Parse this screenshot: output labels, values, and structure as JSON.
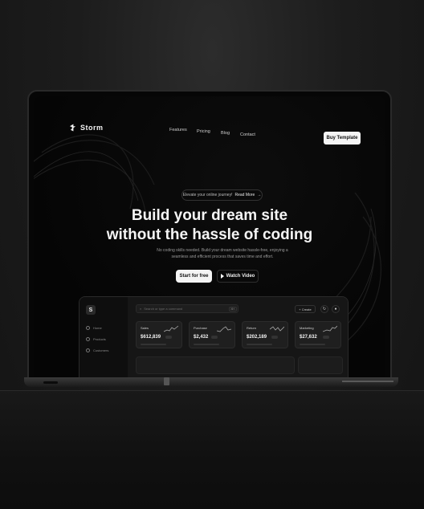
{
  "brand": {
    "name": "Storm"
  },
  "nav": {
    "items": [
      "Features",
      "Pricing",
      "Blog",
      "Contact"
    ],
    "cta": "Buy Template"
  },
  "hero": {
    "pill_text": "Elevate your online journey!",
    "pill_link": "Read More",
    "title_line1": "Build your dream site",
    "title_line2": "without the hassle of coding",
    "subtitle_line1": "No coding skills needed. Build your dream website hassle-free, enjoying a",
    "subtitle_line2": "seamless and efficient process that saves time and effort.",
    "primary_button": "Start for free",
    "secondary_button": "Watch Video"
  },
  "dashboard": {
    "logo_letter": "S",
    "sidebar": [
      "Home",
      "Products",
      "Customers"
    ],
    "search_placeholder": "Search or type a command",
    "shortcut": "⌘K",
    "create_label": "+ Create",
    "cards": [
      {
        "label": "Sales",
        "value": "$612,839"
      },
      {
        "label": "Purchase",
        "value": "$2,432"
      },
      {
        "label": "Return",
        "value": "$202,189"
      },
      {
        "label": "Marketing",
        "value": "$27,632"
      }
    ]
  },
  "colors": {
    "background": "#1a1a1a",
    "screen": "#050505",
    "accent_light": "#f4f4f4"
  }
}
